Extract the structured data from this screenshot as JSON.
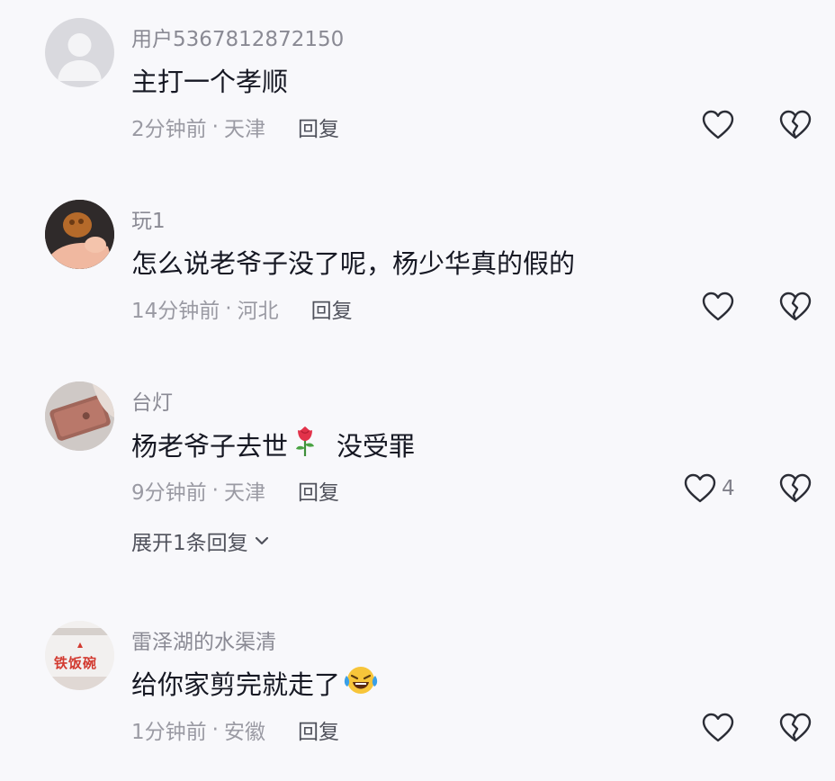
{
  "comments": [
    {
      "username": "用户5367812872150",
      "text": "主打一个孝顺",
      "time": "2分钟前",
      "sep": "·",
      "location": "天津",
      "reply_label": "回复",
      "likes": ""
    },
    {
      "username": "玩1",
      "text": "怎么说老爷子没了呢，杨少华真的假的",
      "time": "14分钟前",
      "sep": "·",
      "location": "河北",
      "reply_label": "回复",
      "likes": ""
    },
    {
      "username": "台灯",
      "text_before": "杨老爷子去世",
      "emoji": "rose-emoji",
      "text_after": "没受罪",
      "time": "9分钟前",
      "sep": "·",
      "location": "天津",
      "reply_label": "回复",
      "likes": "4",
      "expand_label": "展开1条回复"
    },
    {
      "username": "雷泽湖的水渠清",
      "text": "给你家剪完就走了",
      "emoji": "crying-laughing-emoji",
      "time": "1分钟前",
      "sep": "·",
      "location": "安徽",
      "reply_label": "回复",
      "likes": ""
    }
  ],
  "avatar_sign_text": "铁饭碗",
  "colors": {
    "background": "#f8f8fb",
    "text": "#161823",
    "muted": "#9a9aa3",
    "icon": "#2b2d36"
  }
}
